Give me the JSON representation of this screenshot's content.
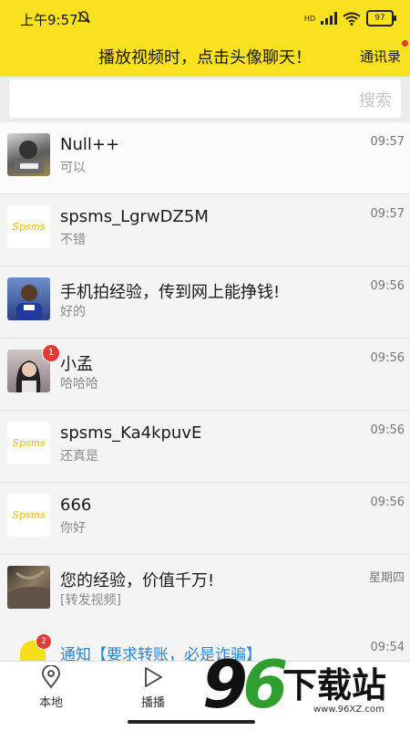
{
  "status_bar": {
    "time": "上午9:57",
    "network": "HD",
    "battery": "97"
  },
  "header": {
    "title": "播放视频时，点击头像聊天！",
    "contacts_label": "通讯录"
  },
  "search": {
    "placeholder": "搜索"
  },
  "conversations": [
    {
      "name": "Null++",
      "preview": "可以",
      "time": "09:57"
    },
    {
      "name": "spsms_LgrwDZ5M",
      "preview": "不错",
      "time": "09:57",
      "logo": "Spsms"
    },
    {
      "name": "手机拍经验，传到网上能挣钱!",
      "preview": "好的",
      "time": "09:56"
    },
    {
      "name": "小孟",
      "preview": "哈哈哈",
      "time": "09:56",
      "badge": "1"
    },
    {
      "name": "spsms_Ka4kpuvE",
      "preview": "还真是",
      "time": "09:56",
      "logo": "Spsms"
    },
    {
      "name": "666",
      "preview": "你好",
      "time": "09:56",
      "logo": "Spsms"
    },
    {
      "name": "您的经验，价值千万!",
      "preview": "[转发视频]",
      "time": "星期四"
    }
  ],
  "notification": {
    "name": "通知【要求转账，必是诈骗】",
    "time": "09:54",
    "badge": "2"
  },
  "tabs": [
    {
      "label": "本地",
      "icon": "location-pin-icon"
    },
    {
      "label": "播播",
      "icon": "play-triangle-icon"
    }
  ],
  "watermark": {
    "brand": "下载站",
    "url": "www.96XZ.com"
  },
  "colors": {
    "header_yellow": "#f9e11f",
    "badge_red": "#e53935",
    "notify_blue": "#2c85c9"
  }
}
